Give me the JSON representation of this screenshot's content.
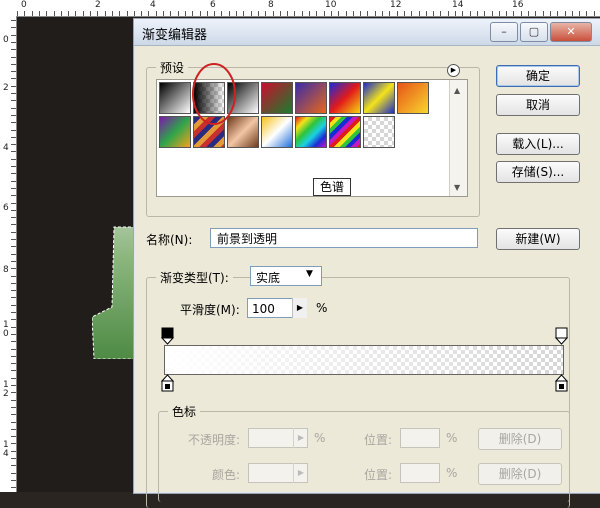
{
  "ruler_top": {
    "numbers": [
      "0",
      "2",
      "4",
      "6",
      "8",
      "10",
      "12",
      "14",
      "16"
    ]
  },
  "ruler_left": {
    "numbers": [
      "0",
      "2",
      "4",
      "6",
      "8",
      "1\n0",
      "1\n2",
      "1\n4"
    ]
  },
  "dialog": {
    "title": "渐变编辑器",
    "presets_label": "预设",
    "tooltip": "色谱",
    "buttons": {
      "ok": "确定",
      "cancel": "取消",
      "load": "载入(L)...",
      "save": "存储(S)...",
      "new": "新建(W)"
    },
    "name_label": "名称(N):",
    "name_value": "前景到透明",
    "gradient_type_label": "渐变类型(T):",
    "gradient_type_value": "实底",
    "smoothness_label": "平滑度(M):",
    "smoothness_value": "100",
    "smoothness_unit": "%",
    "stops": {
      "label": "色标",
      "opacity_label": "不透明度:",
      "percent": "%",
      "position_label": "位置:",
      "delete_label": "删除(D)",
      "color_label": "颜色:"
    }
  },
  "colors": {
    "selection_circle": "#cc2222",
    "shape_green": "#6aa35a"
  }
}
